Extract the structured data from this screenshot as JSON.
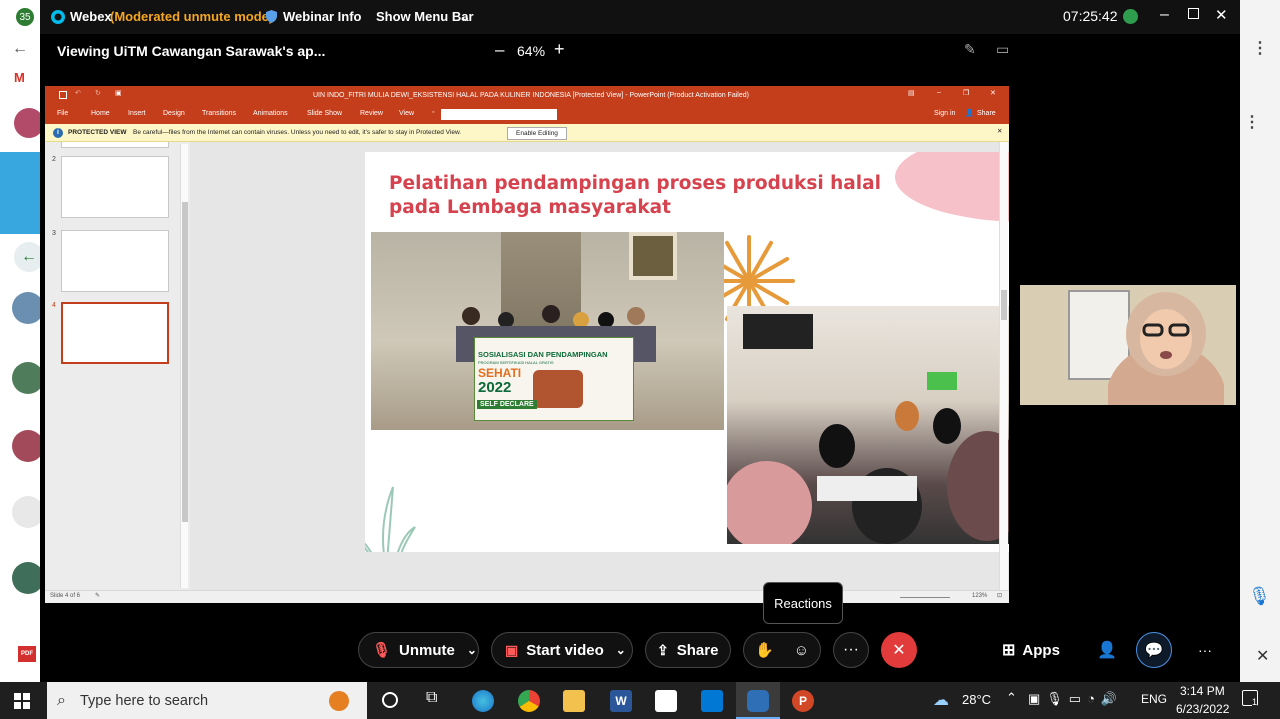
{
  "webex": {
    "app_name": "Webex",
    "mode": "(Moderated unmute mode)",
    "webinar_info": "Webinar Info",
    "show_menu_bar": "Show Menu Bar",
    "clock": "07:25:42",
    "viewing": "Viewing UiTM Cawangan Sarawak's ap...",
    "zoom": "64%",
    "notification_badge": "35"
  },
  "ppt": {
    "window_title": "UIN INDO_FITRI MULIA DEWI_EKSISTENSI HALAL PADA KULINER INDONESIA [Protected View] - PowerPoint (Product Activation Failed)",
    "tabs": [
      "File",
      "Home",
      "Insert",
      "Design",
      "Transitions",
      "Animations",
      "Slide Show",
      "Review",
      "View"
    ],
    "sign_in": "Sign in",
    "share": "Share",
    "protected_label": "PROTECTED VIEW",
    "protected_msg": "Be careful—files from the Internet can contain viruses. Unless you need to edit, it's safer to stay in Protected View.",
    "enable_editing": "Enable Editing",
    "thumb_numbers": [
      "2",
      "3",
      "4"
    ],
    "status_left": "Slide 4 of 6",
    "status_zoom": "123%",
    "slide_title": "Pelatihan pendampingan proses produksi halal pada Lembaga masyarakat",
    "banner": {
      "line1": "SOSIALISASI DAN PENDAMPINGAN",
      "line2": "PROGRAM SERTIFIKASI HALAL GRATIS",
      "sehati": "SEHATI",
      "year": "2022",
      "self_declare": "SELF DECLARE"
    }
  },
  "controls": {
    "unmute": "Unmute",
    "start_video": "Start video",
    "share": "Share",
    "apps": "Apps",
    "reactions_tooltip": "Reactions"
  },
  "taskbar": {
    "search_placeholder": "Type here to search",
    "temperature": "28°C",
    "language": "ENG",
    "time": "3:14 PM",
    "date": "6/23/2022",
    "notifications": "1"
  },
  "colors": {
    "ppt_red": "#c43e1c",
    "title_pink": "#d6434e",
    "webex_orange": "#f5a623",
    "end_red": "#e23b3b"
  }
}
